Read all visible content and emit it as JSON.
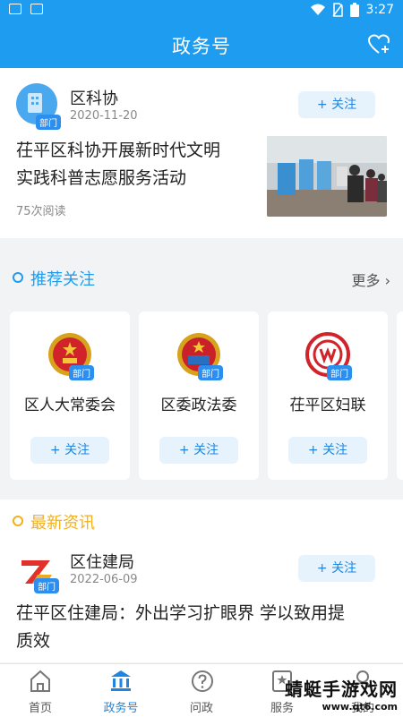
{
  "status_bar": {
    "time": "3:27"
  },
  "header": {
    "title": "政务号",
    "fav_icon": "heart-plus-icon"
  },
  "featured": {
    "org_name": "区科协",
    "badge": "部门",
    "date": "2020-11-20",
    "follow_label": "+ 关注",
    "headline_line1": "茌平区科协开展新时代文明",
    "headline_line2": "实践科普志愿服务活动",
    "reads": "75次阅读"
  },
  "recommend": {
    "title": "推荐关注",
    "more_label": "更多",
    "accent": "#1e9cf0",
    "items": [
      {
        "name": "区人大常委会",
        "badge": "部门",
        "follow_label": "+ 关注"
      },
      {
        "name": "区委政法委",
        "badge": "部门",
        "follow_label": "+ 关注"
      },
      {
        "name": "茌平区妇联",
        "badge": "部门",
        "follow_label": "+ 关注"
      }
    ]
  },
  "latest": {
    "title": "最新资讯",
    "accent": "#f2b01e",
    "item": {
      "org_name": "区住建局",
      "badge": "部门",
      "date": "2022-06-09",
      "follow_label": "+ 关注",
      "headline_line1": "茌平区住建局：外出学习扩眼界 学以致用提",
      "headline_line2": "质效"
    }
  },
  "tabbar": {
    "tabs": [
      {
        "label": "首页",
        "icon": "home-icon"
      },
      {
        "label": "政务号",
        "icon": "government-building-icon"
      },
      {
        "label": "问政",
        "icon": "question-icon"
      },
      {
        "label": "服务",
        "icon": "star-service-icon"
      },
      {
        "label": "我的",
        "icon": "user-icon"
      }
    ],
    "active_color": "#1e86e0"
  },
  "watermark": {
    "line1": "蜻蜓手游戏网",
    "line2": "www.qt6.com"
  }
}
